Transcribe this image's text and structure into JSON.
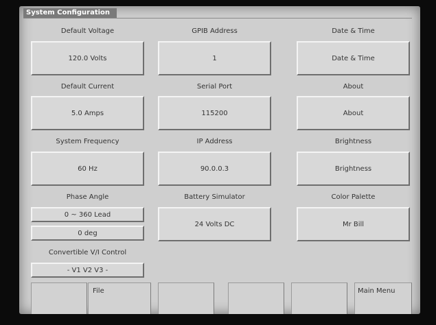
{
  "window": {
    "title": "System Configuration"
  },
  "col1": {
    "voltage_label": "Default Voltage",
    "voltage_value": "120.0 Volts",
    "current_label": "Default Current",
    "current_value": "5.0 Amps",
    "frequency_label": "System Frequency",
    "frequency_value": "60 Hz",
    "phase_label": "Phase Angle",
    "phase_mode": "0 ~ 360 Lead",
    "phase_value": "0 deg",
    "convertible_label": "Convertible V/I Control",
    "convertible_value": "- V1 V2 V3 -"
  },
  "col2": {
    "gpib_label": "GPIB Address",
    "gpib_value": "1",
    "serial_label": "Serial Port",
    "serial_value": "115200",
    "ip_label": "IP Address",
    "ip_value": "90.0.0.3",
    "battery_label": "Battery Simulator",
    "battery_value": "24 Volts DC"
  },
  "col3": {
    "datetime_label": "Date & Time",
    "datetime_button": "Date & Time",
    "about_label": "About",
    "about_button": "About",
    "brightness_label": "Brightness",
    "brightness_button": "Brightness",
    "palette_label": "Color Palette",
    "palette_value": "Mr Bill"
  },
  "function_keys": {
    "f1": "",
    "f2": "File",
    "f3": "",
    "f4": "",
    "f5": "",
    "f6": "Main Menu"
  }
}
